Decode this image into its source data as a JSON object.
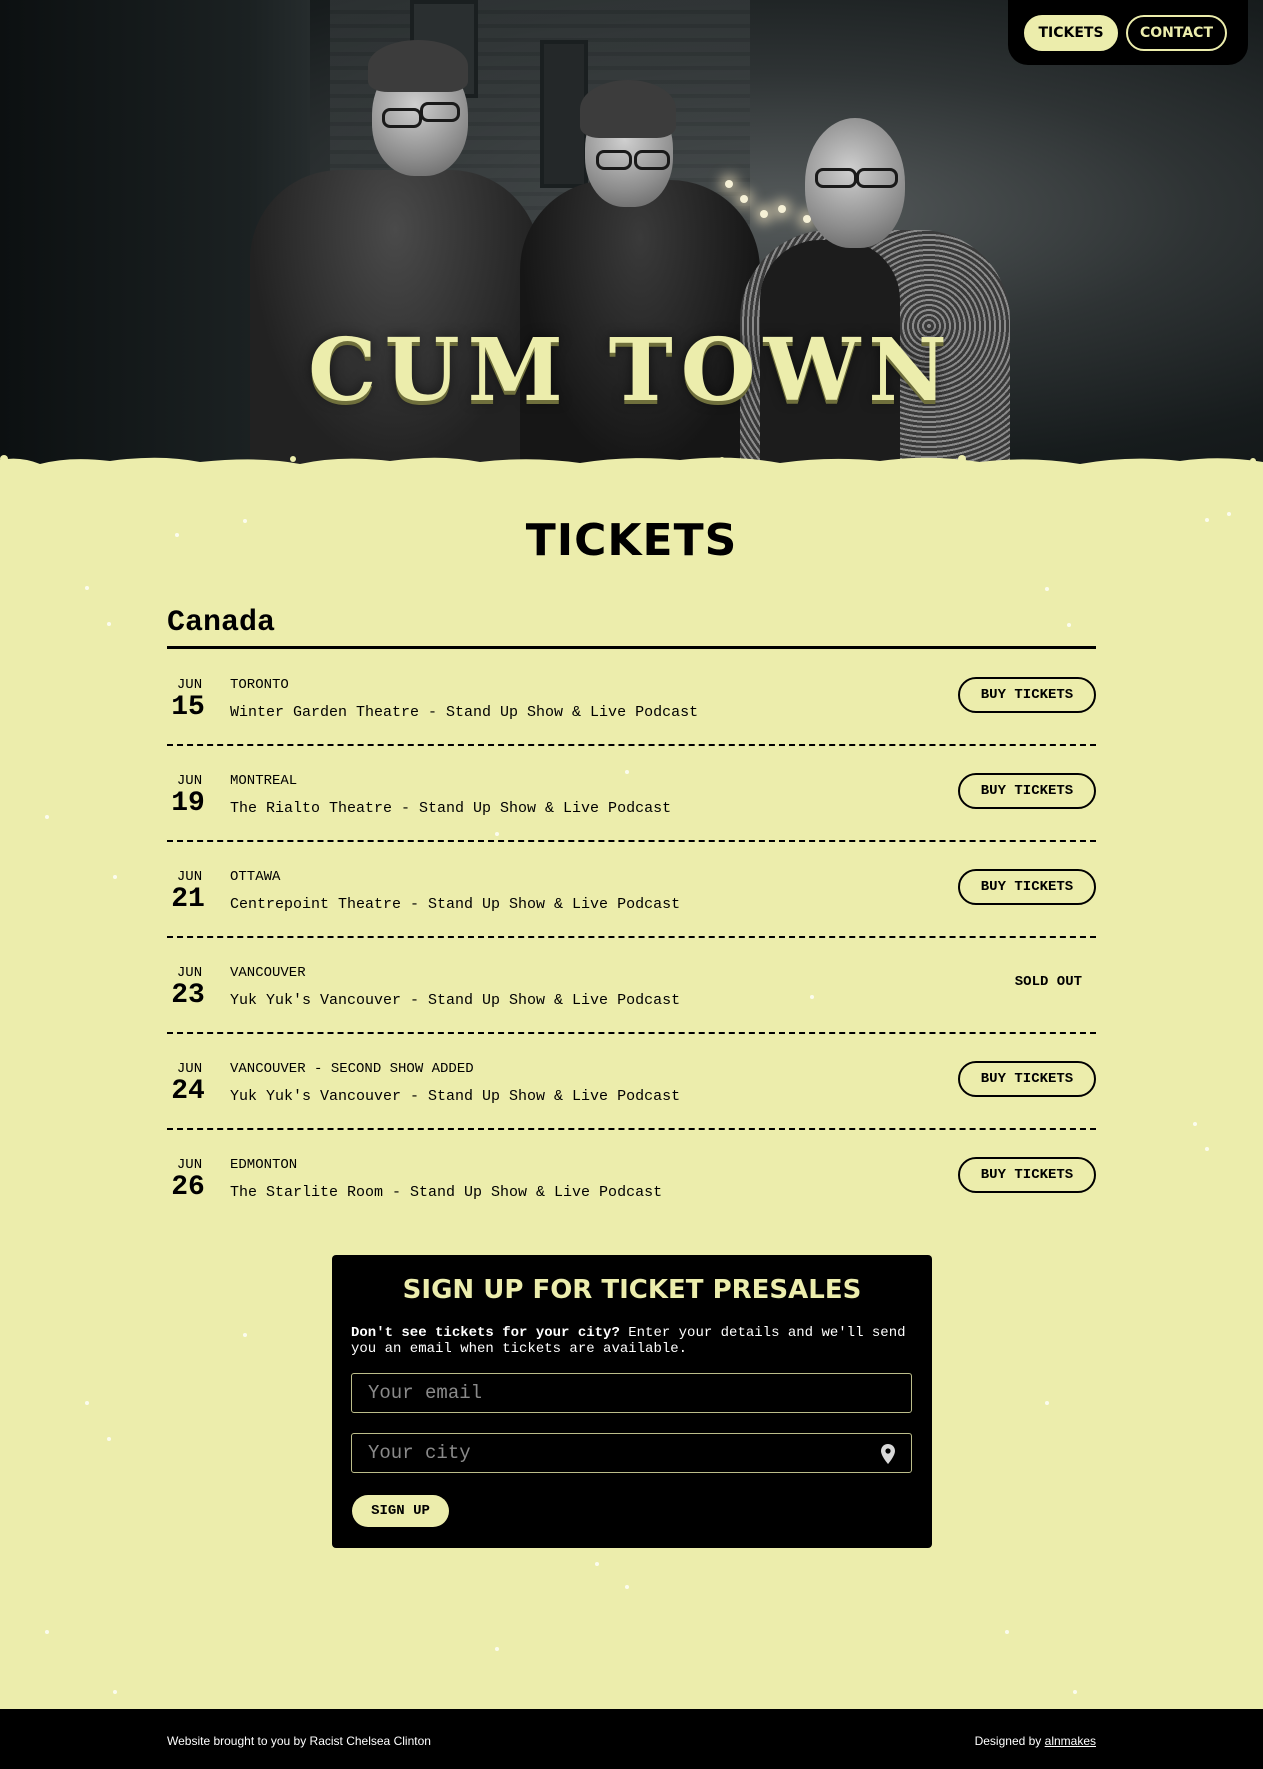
{
  "nav": {
    "tickets_label": "TICKETS",
    "contact_label": "CONTACT"
  },
  "hero": {
    "logo_text": "CUM TOWN"
  },
  "main": {
    "title": "TICKETS",
    "country": "Canada",
    "buy_label": "BUY TICKETS",
    "shows": [
      {
        "month": "JUN",
        "day": "15",
        "city": "TORONTO",
        "venue": "Winter Garden Theatre - Stand Up Show & Live Podcast",
        "status": "BUY TICKETS"
      },
      {
        "month": "JUN",
        "day": "19",
        "city": "MONTREAL",
        "venue": "The Rialto Theatre - Stand Up Show & Live Podcast",
        "status": "BUY TICKETS"
      },
      {
        "month": "JUN",
        "day": "21",
        "city": "OTTAWA",
        "venue": "Centrepoint Theatre - Stand Up Show & Live Podcast",
        "status": "BUY TICKETS"
      },
      {
        "month": "JUN",
        "day": "23",
        "city": "VANCOUVER",
        "venue": "Yuk Yuk's Vancouver - Stand Up Show & Live Podcast",
        "status": "SOLD OUT"
      },
      {
        "month": "JUN",
        "day": "24",
        "city": "VANCOUVER - SECOND SHOW ADDED",
        "venue": "Yuk Yuk's Vancouver - Stand Up Show & Live Podcast",
        "status": "BUY TICKETS"
      },
      {
        "month": "JUN",
        "day": "26",
        "city": "EDMONTON",
        "venue": "The Starlite Room - Stand Up Show & Live Podcast",
        "status": "BUY TICKETS"
      }
    ]
  },
  "signup": {
    "title": "SIGN UP FOR TICKET PRESALES",
    "desc_bold": "Don't see tickets for your city?",
    "desc_rest": " Enter your details and we'll send you an email when tickets are available.",
    "email_placeholder": "Your email",
    "city_placeholder": "Your city",
    "button_label": "SIGN UP",
    "pin_icon": "map-pin-icon"
  },
  "footer": {
    "left_text": "Website brought to you by Racist Chelsea Clinton",
    "designed_by": "Designed by ",
    "designer_link": "alnmakes"
  },
  "colors": {
    "accent": "#ecedac",
    "dark": "#000000"
  }
}
